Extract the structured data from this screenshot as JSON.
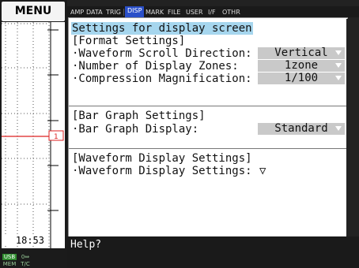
{
  "menu": {
    "label": "MENU"
  },
  "tabs": [
    {
      "label": "AMP",
      "active": false
    },
    {
      "label": "DATA",
      "active": false
    },
    {
      "label": "TRIG",
      "active": false
    },
    {
      "label": "DISP",
      "active": true
    },
    {
      "label": "MARK",
      "active": false
    },
    {
      "label": "FILE",
      "active": false
    },
    {
      "label": "USER",
      "active": false
    },
    {
      "label": "I/F",
      "active": false
    },
    {
      "label": "OTHR",
      "active": false
    }
  ],
  "screen_title": "Settings for display screen",
  "format_section": {
    "heading": "[Format Settings]",
    "items": [
      {
        "label": "·Waveform Scroll Direction:",
        "value": "Vertical"
      },
      {
        "label": "·Number of Display Zones:",
        "value": "1zone"
      },
      {
        "label": "·Compression Magnification:",
        "value": "1/100"
      }
    ]
  },
  "bar_section": {
    "heading": "[Bar Graph Settings]",
    "items": [
      {
        "label": "·Bar Graph Display:",
        "value": "Standard"
      }
    ]
  },
  "waveform_section": {
    "heading": "[Waveform Display Settings]",
    "items": [
      {
        "label": "·Waveform Display Settings:",
        "value": "▽"
      }
    ]
  },
  "channel_marker": "1",
  "clock": "18:53",
  "status": {
    "usb": "USB",
    "mem": "MEM",
    "pc": "0⇔",
    "tc": "T/C"
  },
  "help": {
    "label": "Help?"
  },
  "colors": {
    "active_tab": "#2a4fc8",
    "title_highlight": "#a6d6ee",
    "value_box": "#c9c9c9",
    "status_usb": "#2e8b2e",
    "trace": "#d22"
  }
}
